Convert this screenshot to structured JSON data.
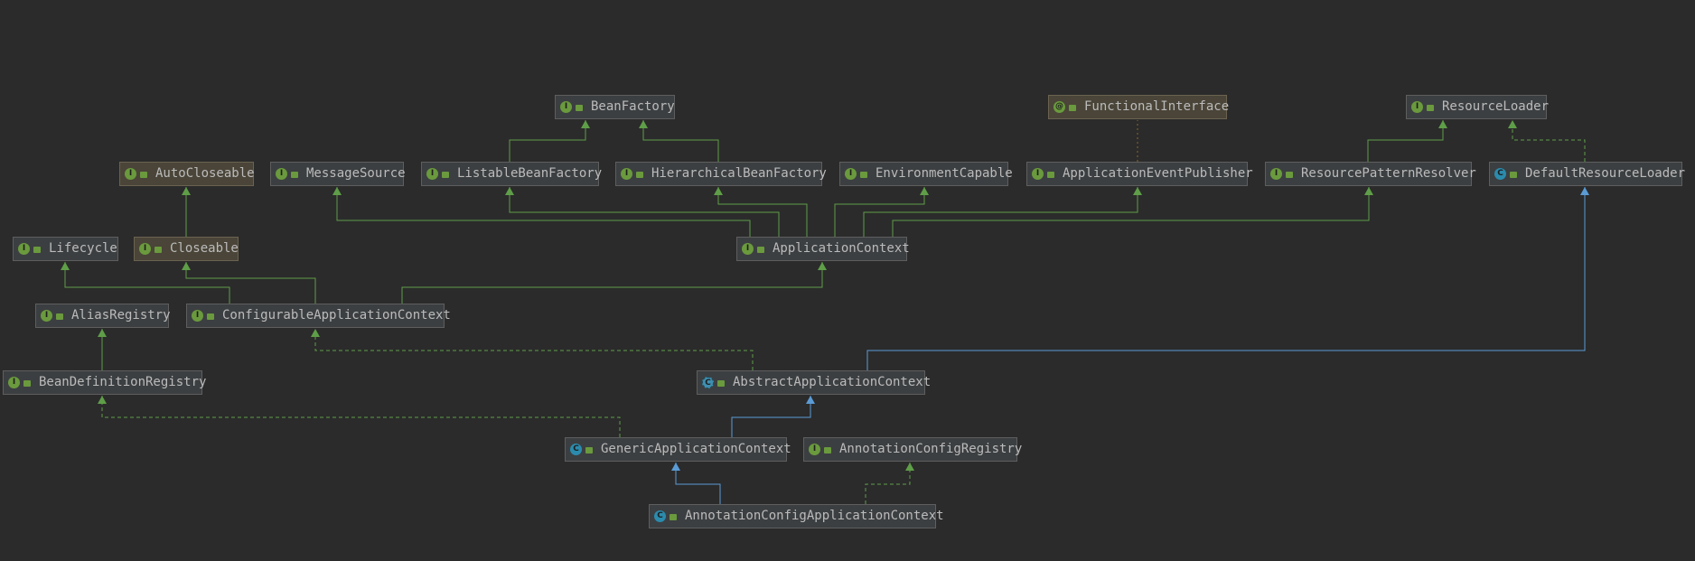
{
  "colors": {
    "background": "#2b2b2b",
    "interface_badge": "#6a9a3d",
    "class_badge": "#2b8bad",
    "extends_edge": "#5f9e48",
    "class_extends_edge": "#5b9bd5"
  },
  "nodes": {
    "bean_factory": {
      "label": "BeanFactory",
      "kind": "interface"
    },
    "functional_interface": {
      "label": "FunctionalInterface",
      "kind": "annotation"
    },
    "resource_loader": {
      "label": "ResourceLoader",
      "kind": "interface"
    },
    "auto_closeable": {
      "label": "AutoCloseable",
      "kind": "interface"
    },
    "message_source": {
      "label": "MessageSource",
      "kind": "interface"
    },
    "listable_bean_factory": {
      "label": "ListableBeanFactory",
      "kind": "interface"
    },
    "hierarchical_bean_factory": {
      "label": "HierarchicalBeanFactory",
      "kind": "interface"
    },
    "environment_capable": {
      "label": "EnvironmentCapable",
      "kind": "interface"
    },
    "application_event_publisher": {
      "label": "ApplicationEventPublisher",
      "kind": "interface"
    },
    "resource_pattern_resolver": {
      "label": "ResourcePatternResolver",
      "kind": "interface"
    },
    "default_resource_loader": {
      "label": "DefaultResourceLoader",
      "kind": "class"
    },
    "lifecycle": {
      "label": "Lifecycle",
      "kind": "interface"
    },
    "closeable": {
      "label": "Closeable",
      "kind": "interface"
    },
    "application_context": {
      "label": "ApplicationContext",
      "kind": "interface"
    },
    "alias_registry": {
      "label": "AliasRegistry",
      "kind": "interface"
    },
    "configurable_application_context": {
      "label": "ConfigurableApplicationContext",
      "kind": "interface"
    },
    "bean_definition_registry": {
      "label": "BeanDefinitionRegistry",
      "kind": "interface"
    },
    "abstract_application_context": {
      "label": "AbstractApplicationContext",
      "kind": "abstract-class"
    },
    "generic_application_context": {
      "label": "GenericApplicationContext",
      "kind": "class"
    },
    "annotation_config_registry": {
      "label": "AnnotationConfigRegistry",
      "kind": "interface"
    },
    "annotation_config_application_context": {
      "label": "AnnotationConfigApplicationContext",
      "kind": "class"
    }
  },
  "edges": [
    {
      "from": "listable_bean_factory",
      "to": "bean_factory",
      "type": "extends"
    },
    {
      "from": "hierarchical_bean_factory",
      "to": "bean_factory",
      "type": "extends"
    },
    {
      "from": "resource_pattern_resolver",
      "to": "resource_loader",
      "type": "extends"
    },
    {
      "from": "default_resource_loader",
      "to": "resource_loader",
      "type": "implements"
    },
    {
      "from": "application_event_publisher",
      "to": "functional_interface",
      "type": "annotated"
    },
    {
      "from": "closeable",
      "to": "auto_closeable",
      "type": "extends"
    },
    {
      "from": "application_context",
      "to": "message_source",
      "type": "extends"
    },
    {
      "from": "application_context",
      "to": "listable_bean_factory",
      "type": "extends"
    },
    {
      "from": "application_context",
      "to": "hierarchical_bean_factory",
      "type": "extends"
    },
    {
      "from": "application_context",
      "to": "environment_capable",
      "type": "extends"
    },
    {
      "from": "application_context",
      "to": "application_event_publisher",
      "type": "extends"
    },
    {
      "from": "application_context",
      "to": "resource_pattern_resolver",
      "type": "extends"
    },
    {
      "from": "configurable_application_context",
      "to": "lifecycle",
      "type": "extends"
    },
    {
      "from": "configurable_application_context",
      "to": "closeable",
      "type": "extends"
    },
    {
      "from": "configurable_application_context",
      "to": "application_context",
      "type": "extends"
    },
    {
      "from": "bean_definition_registry",
      "to": "alias_registry",
      "type": "extends"
    },
    {
      "from": "abstract_application_context",
      "to": "configurable_application_context",
      "type": "implements"
    },
    {
      "from": "abstract_application_context",
      "to": "default_resource_loader",
      "type": "class-extends"
    },
    {
      "from": "generic_application_context",
      "to": "abstract_application_context",
      "type": "class-extends"
    },
    {
      "from": "generic_application_context",
      "to": "bean_definition_registry",
      "type": "implements"
    },
    {
      "from": "annotation_config_application_context",
      "to": "generic_application_context",
      "type": "class-extends"
    },
    {
      "from": "annotation_config_application_context",
      "to": "annotation_config_registry",
      "type": "implements"
    }
  ]
}
